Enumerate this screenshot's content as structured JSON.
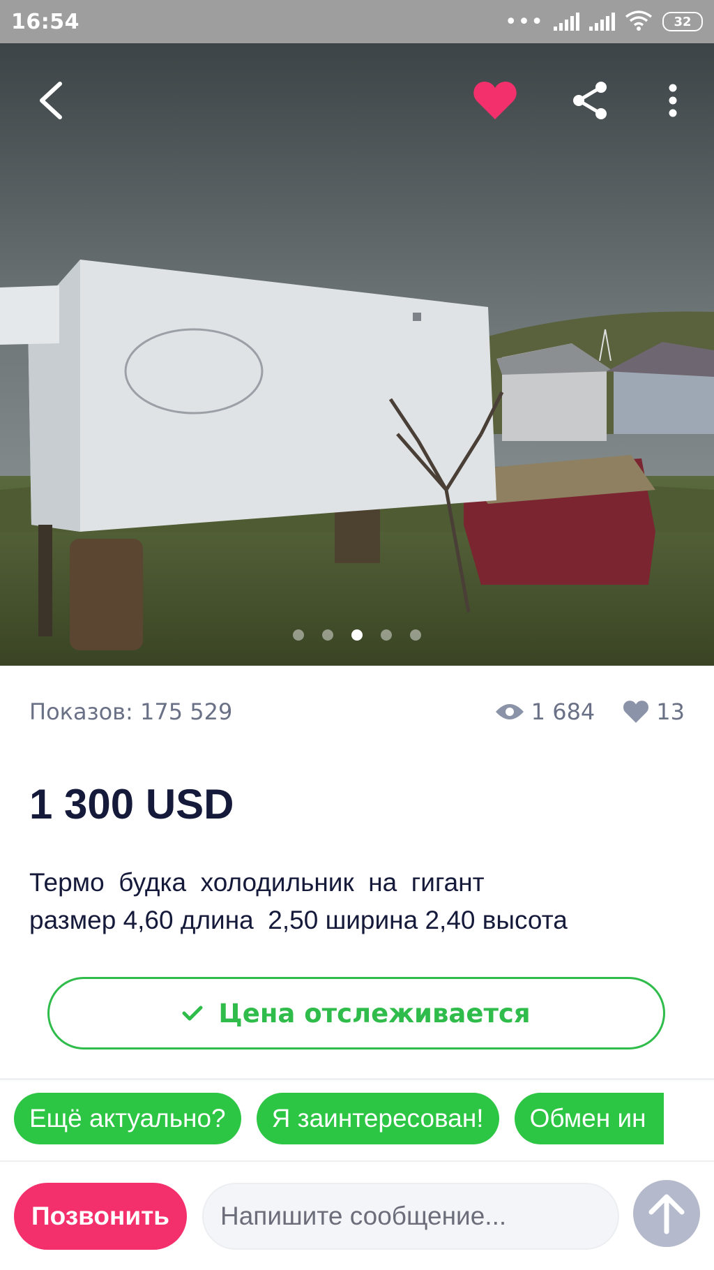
{
  "status_bar": {
    "time": "16:54",
    "battery": "32",
    "icons": [
      "more-dots-icon",
      "signal-icon",
      "signal-icon",
      "wifi-icon",
      "battery-icon"
    ]
  },
  "toolbar": {
    "back_icon": "chevron-left-icon",
    "favorite_icon": "heart-icon",
    "favorite_color": "#f4306c",
    "share_icon": "share-icon",
    "menu_icon": "more-vertical-icon"
  },
  "gallery": {
    "photo_count": 5,
    "active_index": 2
  },
  "stats": {
    "impressions": "Показов: 175 529",
    "views": "1 684",
    "likes": "13"
  },
  "listing": {
    "price": "1 300 USD",
    "description_line1": "Термо  будка  холодильник  на  гигант",
    "description_line2": "размер 4,60 длина  2,50 ширина 2,40 высота"
  },
  "track_button": {
    "label": "Цена отслеживается",
    "icon": "check-icon",
    "color": "#2fbc4a"
  },
  "quick_replies": [
    "Ещё актуально?",
    "Я заинтересован!",
    "Обмен ин"
  ],
  "bottom_bar": {
    "call_label": "Позвонить",
    "message_placeholder": "Напишите сообщение...",
    "send_icon": "arrow-up-icon"
  },
  "colors": {
    "accent_green": "#2cc544",
    "accent_pink": "#f4306c",
    "text_dark": "#15193a",
    "text_muted": "#6a7186"
  }
}
